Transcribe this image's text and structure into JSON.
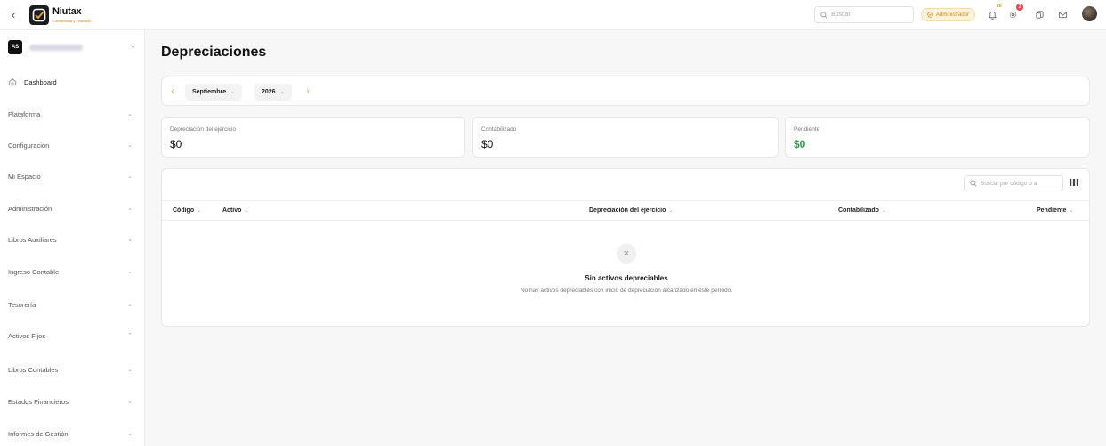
{
  "header": {
    "brand_name": "Niutax",
    "brand_subtitle": "Contabilidad y Finanzas",
    "search_placeholder": "Buscar",
    "role_badge": "Administrador",
    "notifications_count": "30",
    "alerts_count": "2",
    "accent_color": "#c48a1b"
  },
  "sidebar": {
    "org_initials": "AS",
    "items": [
      {
        "label": "Dashboard",
        "icon": "home-icon"
      },
      {
        "label": "Plataforma"
      },
      {
        "label": "Configuración"
      },
      {
        "label": "Mi Espacio"
      },
      {
        "label": "Administración"
      },
      {
        "label": "Libros Auxiliares"
      },
      {
        "label": "Ingreso Contable"
      },
      {
        "label": "Tesorería"
      },
      {
        "label": "Activos Fijos",
        "expanded": true
      },
      {
        "label": "Libros Contables"
      },
      {
        "label": "Estados Financieros"
      },
      {
        "label": "Informes de Gestión"
      }
    ]
  },
  "main": {
    "title": "Depreciaciones",
    "period": {
      "month": "Septiembre",
      "year": "2026"
    },
    "stats": [
      {
        "label": "Depreciación del ejercicio",
        "value": "$0"
      },
      {
        "label": "Contabilizado",
        "value": "$0"
      },
      {
        "label": "Pendiente",
        "value": "$0",
        "color": "#2e9d4b"
      }
    ],
    "table": {
      "search_placeholder": "Buscar por código o a",
      "columns": [
        "Código",
        "Activo",
        "Depreciación del ejercicio",
        "Contabilizado",
        "Pendiente"
      ],
      "rows": [],
      "empty_title": "Sin activos depreciables",
      "empty_description": "No hay activos depreciables con inicio de depreciación alcanzado en este período."
    }
  }
}
